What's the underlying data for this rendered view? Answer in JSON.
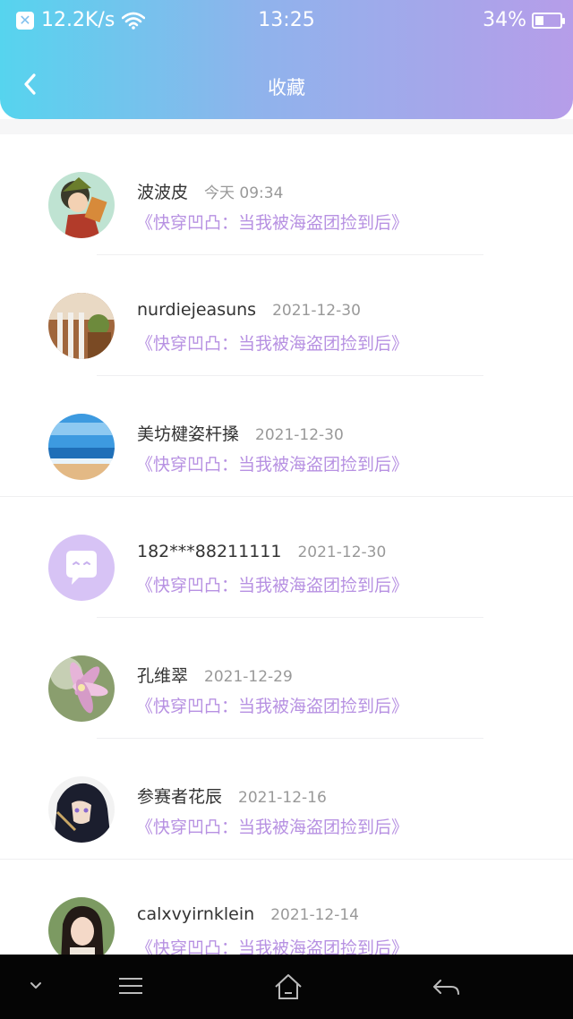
{
  "status_bar": {
    "speed": "12.2K/s",
    "time": "13:25",
    "battery": "34%",
    "battery_level": 0.34
  },
  "nav": {
    "title": "收藏"
  },
  "items": [
    {
      "name": "波波皮",
      "date": "今天 09:34",
      "book": "《快穿凹凸：当我被海盗团捡到后》",
      "avatar": "anime-boy-avatar"
    },
    {
      "name": "nurdiejeasuns",
      "date": "2021-12-30",
      "book": "《快穿凹凸：当我被海盗团捡到后》",
      "avatar": "photo-avatar"
    },
    {
      "name": "美坊楗姿杆搡",
      "date": "2021-12-30",
      "book": "《快穿凹凸：当我被海盗团捡到后》",
      "avatar": "beach-avatar"
    },
    {
      "name": "182***88211111",
      "date": "2021-12-30",
      "book": "《快穿凹凸：当我被海盗团捡到后》",
      "avatar": "default-chat-avatar"
    },
    {
      "name": "孔维翠",
      "date": "2021-12-29",
      "book": "《快穿凹凸：当我被海盗团捡到后》",
      "avatar": "flower-avatar"
    },
    {
      "name": "参赛者花辰",
      "date": "2021-12-16",
      "book": "《快穿凹凸：当我被海盗团捡到后》",
      "avatar": "anime-dark-avatar"
    },
    {
      "name": "calxvyirnklein",
      "date": "2021-12-14",
      "book": "《快穿凹凸：当我被海盗团捡到后》",
      "avatar": "girl-avatar"
    }
  ],
  "colors": {
    "header_gradient_start": "#56d4ee",
    "header_gradient_end": "#b69de9",
    "book_text": "#b791e2",
    "default_avatar_bg": "#d7c3f5"
  }
}
